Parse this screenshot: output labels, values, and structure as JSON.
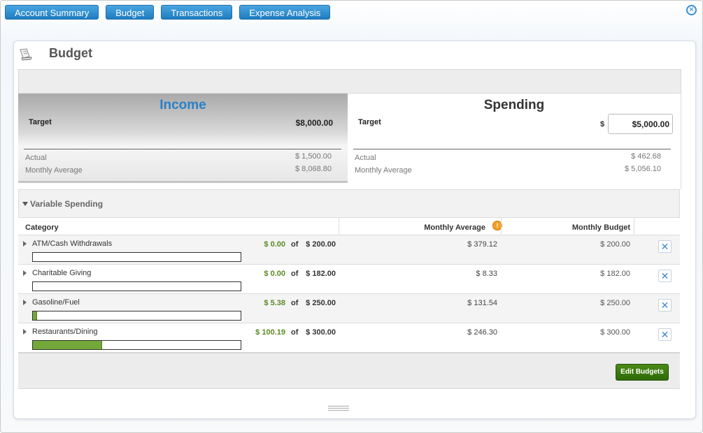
{
  "nav": {
    "tabs": [
      "Account Summary",
      "Budget",
      "Transactions",
      "Expense Analysis"
    ]
  },
  "page": {
    "title": "Budget"
  },
  "income": {
    "title": "Income",
    "target_label": "Target",
    "target_value": "$8,000.00",
    "actual_label": "Actual",
    "actual_value": "$ 1,500.00",
    "avg_label": "Monthly Average",
    "avg_value": "$ 8,068.80"
  },
  "spending": {
    "title": "Spending",
    "target_label": "Target",
    "currency": "$",
    "target_value": "$5,000.00",
    "actual_label": "Actual",
    "actual_value": "$ 462.68",
    "avg_label": "Monthly Average",
    "avg_value": "$ 5,056.10"
  },
  "variable_spending": {
    "title": "Variable Spending",
    "headers": {
      "category": "Category",
      "monthly_average": "Monthly Average",
      "monthly_budget": "Monthly Budget"
    },
    "of_label": "of",
    "rows": [
      {
        "category": "ATM/Cash Withdrawals",
        "spent": "$ 0.00",
        "limit": "$ 200.00",
        "monthly_average": "$ 379.12",
        "monthly_budget": "$ 200.00",
        "progress": 0.0
      },
      {
        "category": "Charitable Giving",
        "spent": "$ 0.00",
        "limit": "$ 182.00",
        "monthly_average": "$ 8.33",
        "monthly_budget": "$ 182.00",
        "progress": 0.0
      },
      {
        "category": "Gasoline/Fuel",
        "spent": "$ 5.38",
        "limit": "$ 250.00",
        "monthly_average": "$ 131.54",
        "monthly_budget": "$ 250.00",
        "progress": 0.0215
      },
      {
        "category": "Restaurants/Dining",
        "spent": "$ 100.19",
        "limit": "$ 300.00",
        "monthly_average": "$ 246.30",
        "monthly_budget": "$ 300.00",
        "progress": 0.334
      }
    ]
  },
  "actions": {
    "edit_budgets": "Edit Budgets"
  },
  "icons": {
    "close": "close-circle-icon",
    "delete": "x-icon",
    "info": "info-icon",
    "budget": "budget-icon"
  },
  "colors": {
    "nav_button": "#1f7cc0",
    "income_title": "#2a80c8",
    "spent_green": "#5a8a24",
    "progress_fill": "#74a83a",
    "edit_button": "#2f6a08"
  }
}
